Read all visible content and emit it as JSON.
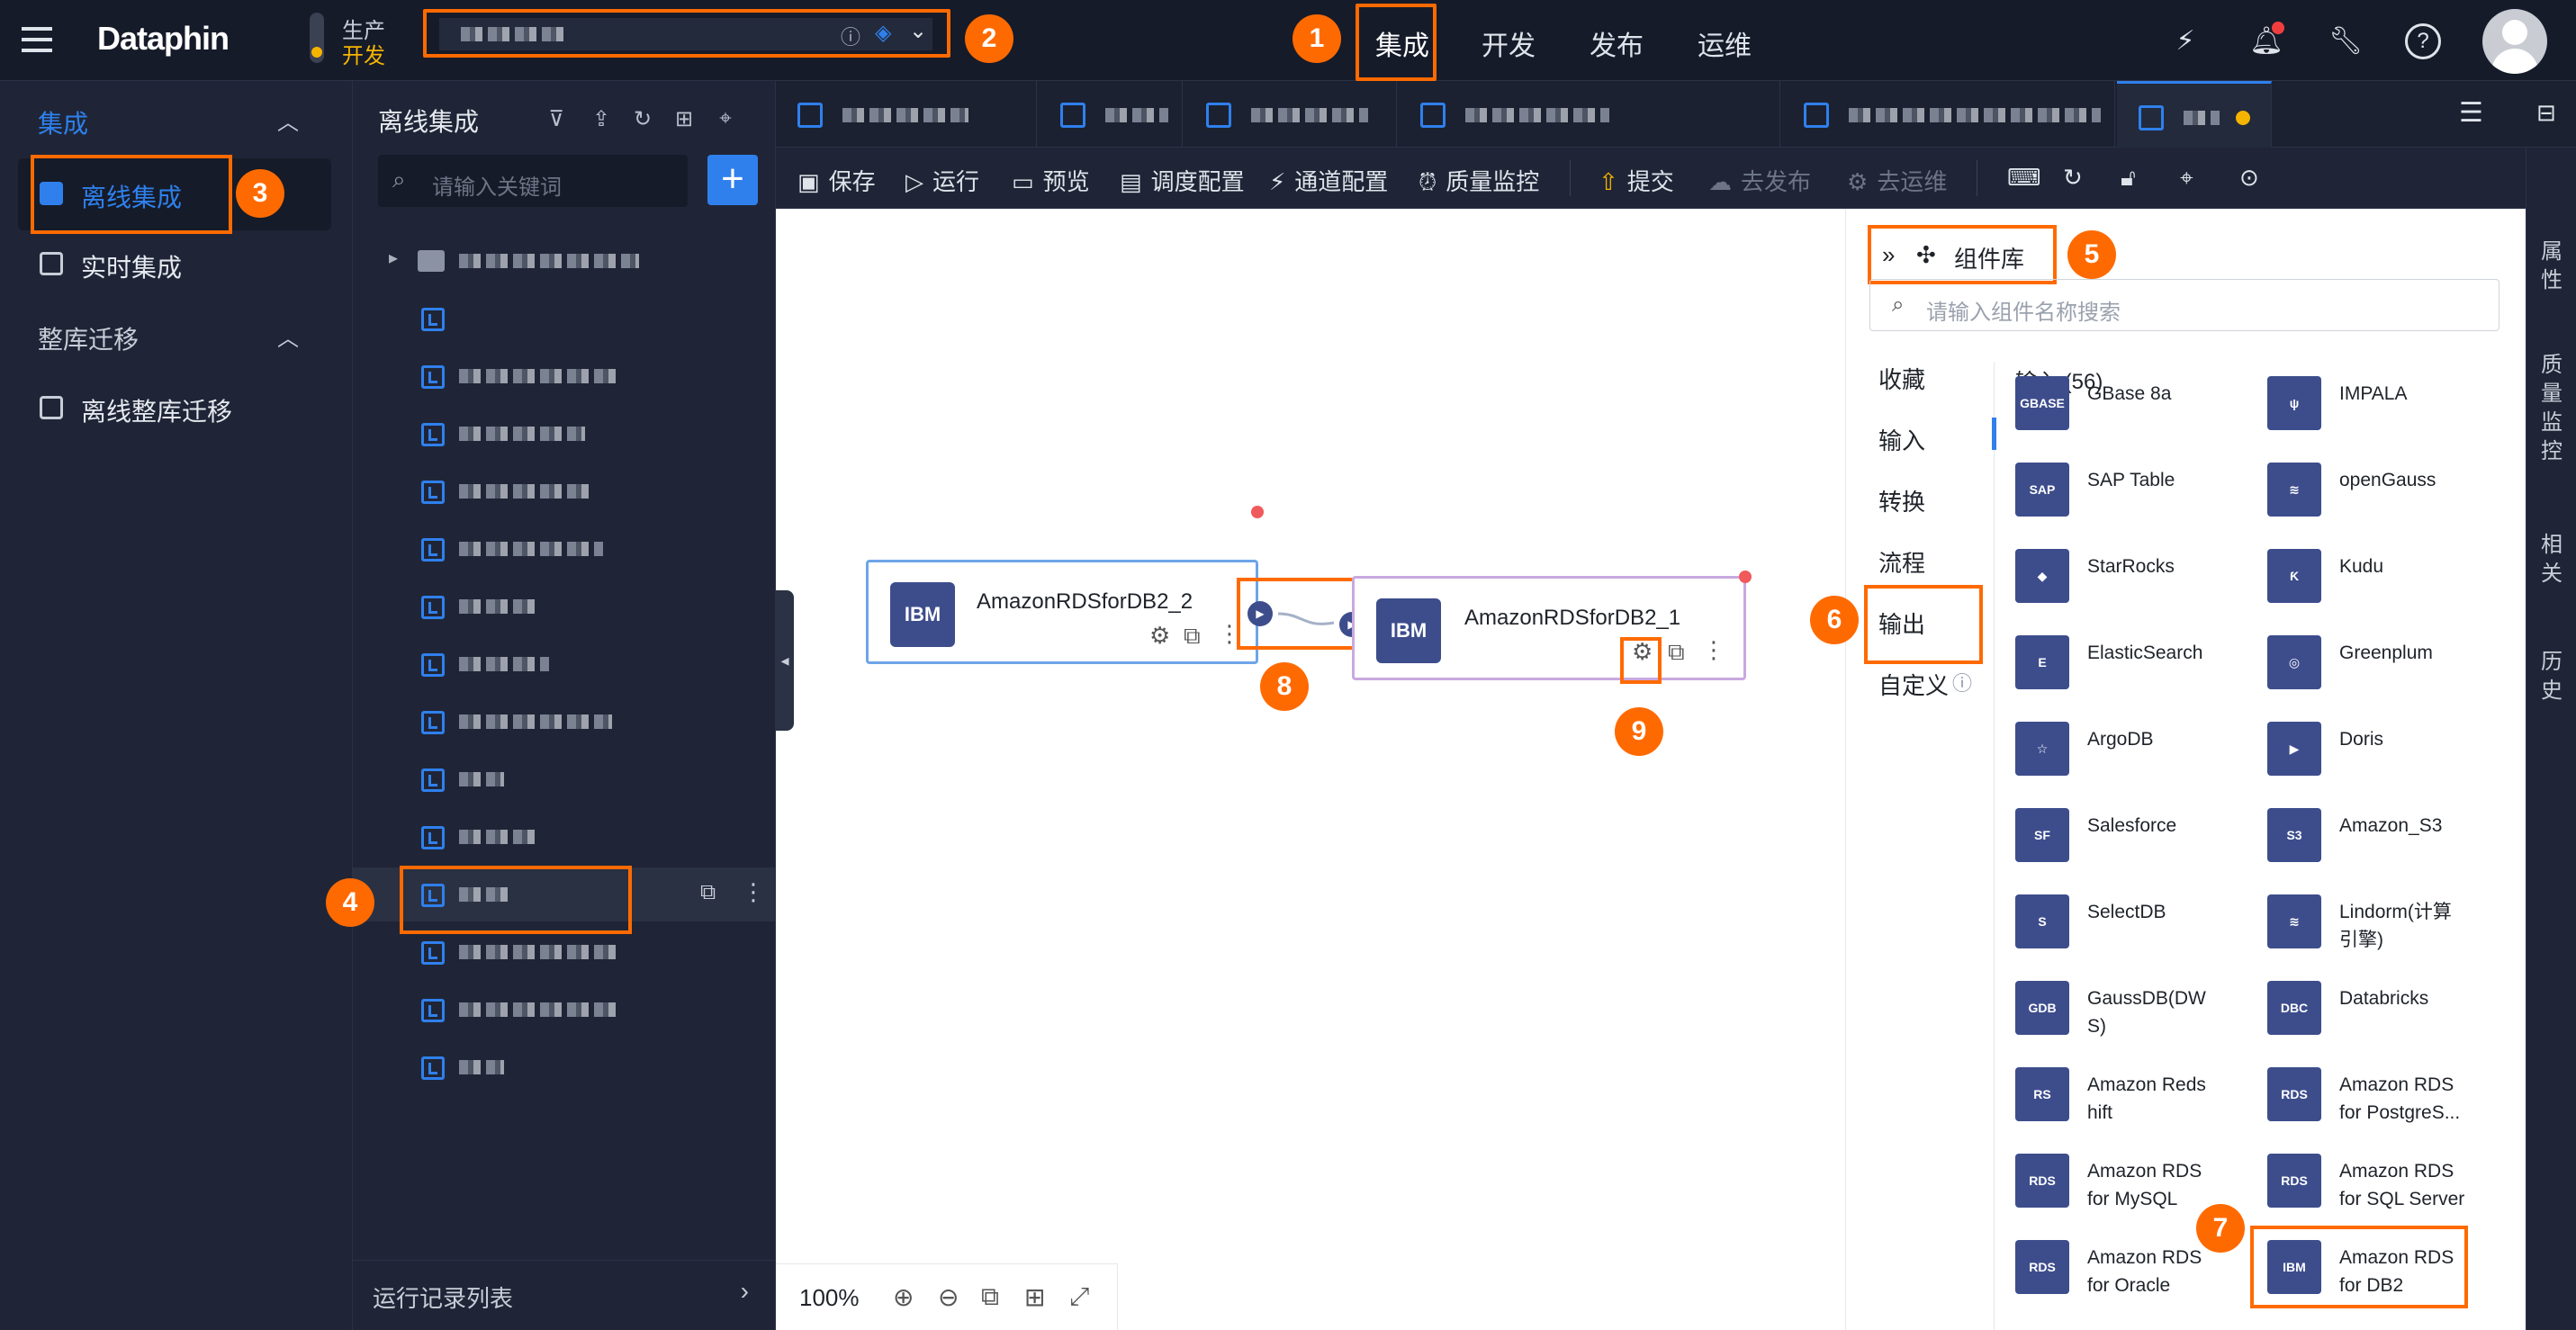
{
  "app": {
    "logo": "Dataphin",
    "env_prod": "生产",
    "env_dev": "开发"
  },
  "topnav": [
    {
      "label": "集成"
    },
    {
      "label": "开发"
    },
    {
      "label": "发布"
    },
    {
      "label": "运维"
    }
  ],
  "badges": [
    "1",
    "2",
    "3",
    "4",
    "5",
    "6",
    "7",
    "8",
    "9"
  ],
  "leftnav": {
    "section1": "集成",
    "items1": [
      "离线集成",
      "实时集成"
    ],
    "section2": "整库迁移",
    "items2": [
      "离线整库迁移"
    ]
  },
  "tree": {
    "title": "离线集成",
    "search_placeholder": "请输入关键词",
    "add": "+",
    "footer": "运行记录列表"
  },
  "toolbar": {
    "save": "保存",
    "run": "运行",
    "preview": "预览",
    "schedule": "调度配置",
    "channel": "通道配置",
    "quality": "质量监控",
    "submit": "提交",
    "publish": "去发布",
    "ops": "去运维"
  },
  "canvas": {
    "node1": "AmazonRDSforDB2_2",
    "node2": "AmazonRDSforDB2_1",
    "node_icon": "IBM",
    "zoom": "100%"
  },
  "library": {
    "title": "组件库",
    "search_placeholder": "请输入组件名称搜索",
    "categories": [
      "收藏",
      "输入",
      "转换",
      "流程",
      "输出",
      "自定义"
    ],
    "group_title": "输入 (56)",
    "components": [
      {
        "name": "GBase 8a",
        "icon": "GBASE"
      },
      {
        "name": "IMPALA",
        "icon": "ψ"
      },
      {
        "name": "SAP Table",
        "icon": "SAP"
      },
      {
        "name": "openGauss",
        "icon": "≋"
      },
      {
        "name": "StarRocks",
        "icon": "◆"
      },
      {
        "name": "Kudu",
        "icon": "Ƙ"
      },
      {
        "name": "ElasticSearch",
        "icon": "E"
      },
      {
        "name": "Greenplum",
        "icon": "◎"
      },
      {
        "name": "ArgoDB",
        "icon": "☆"
      },
      {
        "name": "Doris",
        "icon": "▶"
      },
      {
        "name": "Salesforce",
        "icon": "SF"
      },
      {
        "name": "Amazon_S3",
        "icon": "S3"
      },
      {
        "name": "SelectDB",
        "icon": "S"
      },
      {
        "name": "Lindorm(计算\n引擎)",
        "icon": "≋"
      },
      {
        "name": "GaussDB(DW\nS)",
        "icon": "GDB"
      },
      {
        "name": "Databricks",
        "icon": "DBC"
      },
      {
        "name": "Amazon Reds\nhift",
        "icon": "RS"
      },
      {
        "name": "Amazon RDS\nfor PostgreS...",
        "icon": "RDS"
      },
      {
        "name": "Amazon RDS\nfor MySQL",
        "icon": "RDS"
      },
      {
        "name": "Amazon RDS\nfor SQL Server",
        "icon": "RDS"
      },
      {
        "name": "Amazon RDS\nfor Oracle",
        "icon": "RDS"
      },
      {
        "name": "Amazon RDS\nfor DB2",
        "icon": "IBM"
      }
    ]
  },
  "rail": [
    "属性",
    "质量监控",
    "相关",
    "历史"
  ]
}
